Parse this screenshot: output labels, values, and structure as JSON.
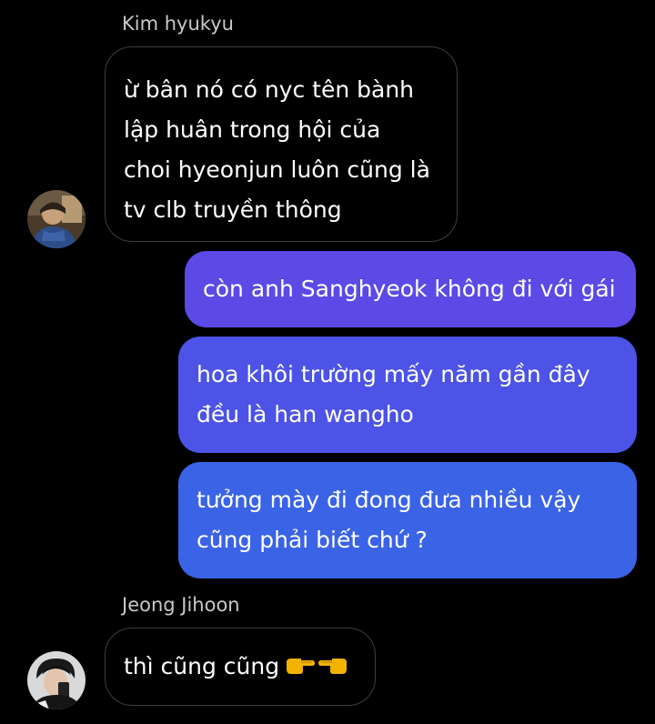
{
  "messages": [
    {
      "sender": "Kim hyukyu",
      "direction": "incoming",
      "lines": [
        "ừ bân nó có nyc tên bành",
        "lập huân trong hội của",
        "choi hyeonjun luôn cũng là",
        "tv clb truyền thông"
      ]
    },
    {
      "direction": "outgoing",
      "lines": [
        "còn anh Sanghyeok không đi với gái"
      ],
      "color": "#5b4ae6"
    },
    {
      "direction": "outgoing",
      "lines": [
        "hoa khôi trường mấy năm gần đây",
        "đều là han wangho"
      ],
      "color": "#4c53e6"
    },
    {
      "direction": "outgoing",
      "lines": [
        "tưởng mày đi đong đưa nhiều vậy",
        "cũng phải biết chứ ?"
      ],
      "color": "#3a63e6"
    },
    {
      "sender": "Jeong Jihoon",
      "direction": "incoming",
      "text": "thì cũng cũng",
      "icons": [
        "pointing-right-hand-icon",
        "pointing-left-hand-icon"
      ]
    }
  ],
  "colors": {
    "background": "#000000",
    "incoming_border": "#3d3d3d",
    "sender_name": "#c9c9c9"
  }
}
